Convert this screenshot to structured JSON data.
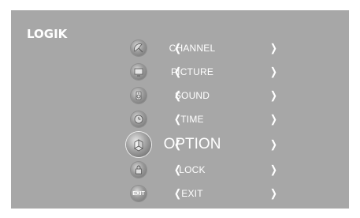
{
  "brand": {
    "logo_text": "LOGIK"
  },
  "navigation": {
    "left_arrow": "❬",
    "right_arrow": "❭"
  },
  "menu": {
    "selected_index": 4,
    "items": [
      {
        "label": "CHANNEL",
        "icon": "satellite-dish-icon"
      },
      {
        "label": "PICTURE",
        "icon": "tv-icon"
      },
      {
        "label": "SOUND",
        "icon": "speaker-icon"
      },
      {
        "label": "TIME",
        "icon": "clock-icon"
      },
      {
        "label": "OPTION",
        "icon": "option-icon"
      },
      {
        "label": "LOCK",
        "icon": "lock-icon"
      },
      {
        "label": "EXIT",
        "icon": "exit-icon",
        "icon_text": "EXIT"
      }
    ]
  },
  "colors": {
    "panel_background": "#a7a7a7",
    "text": "#ffffff"
  }
}
